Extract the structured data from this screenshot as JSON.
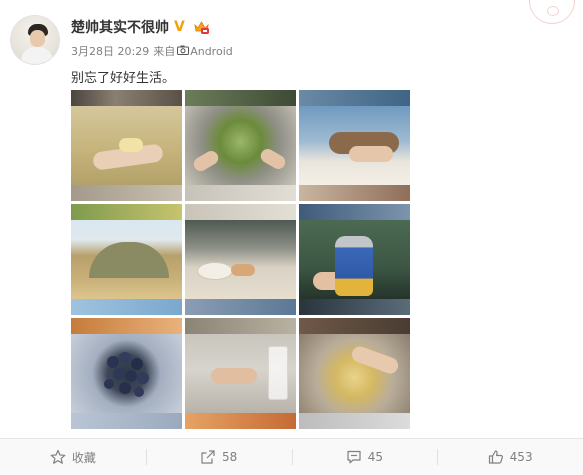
{
  "post": {
    "user": {
      "name": "楚帅其实不很帅",
      "verified_badge_icon": "verified-v-icon",
      "member_badge_icon": "crown-icon"
    },
    "meta": {
      "date": "3月28日 20:29",
      "source_prefix": "来自",
      "source_icon": "camera-icon",
      "source": "Android"
    },
    "text": "别忘了好好生活。",
    "photos": [
      {
        "alt_icon": "photo-hands-pastry"
      },
      {
        "alt_icon": "photo-greens-bowl"
      },
      {
        "alt_icon": "photo-person-lying"
      },
      {
        "alt_icon": "photo-hill-landscape"
      },
      {
        "alt_icon": "photo-plate-cat"
      },
      {
        "alt_icon": "photo-soda-can"
      },
      {
        "alt_icon": "photo-blueberries"
      },
      {
        "alt_icon": "photo-hands-drink"
      },
      {
        "alt_icon": "photo-bowl-pastries"
      }
    ]
  },
  "actions": {
    "favorite": {
      "label": "收藏",
      "icon": "star-icon"
    },
    "repost": {
      "label": "58",
      "icon": "share-icon"
    },
    "comment": {
      "label": "45",
      "icon": "comment-icon"
    },
    "like": {
      "label": "453",
      "icon": "thumbs-up-icon"
    }
  },
  "colors": {
    "name": "#333333",
    "meta": "#808080",
    "verified": "#f2a20a",
    "footer_bg": "#f9f9f9"
  }
}
